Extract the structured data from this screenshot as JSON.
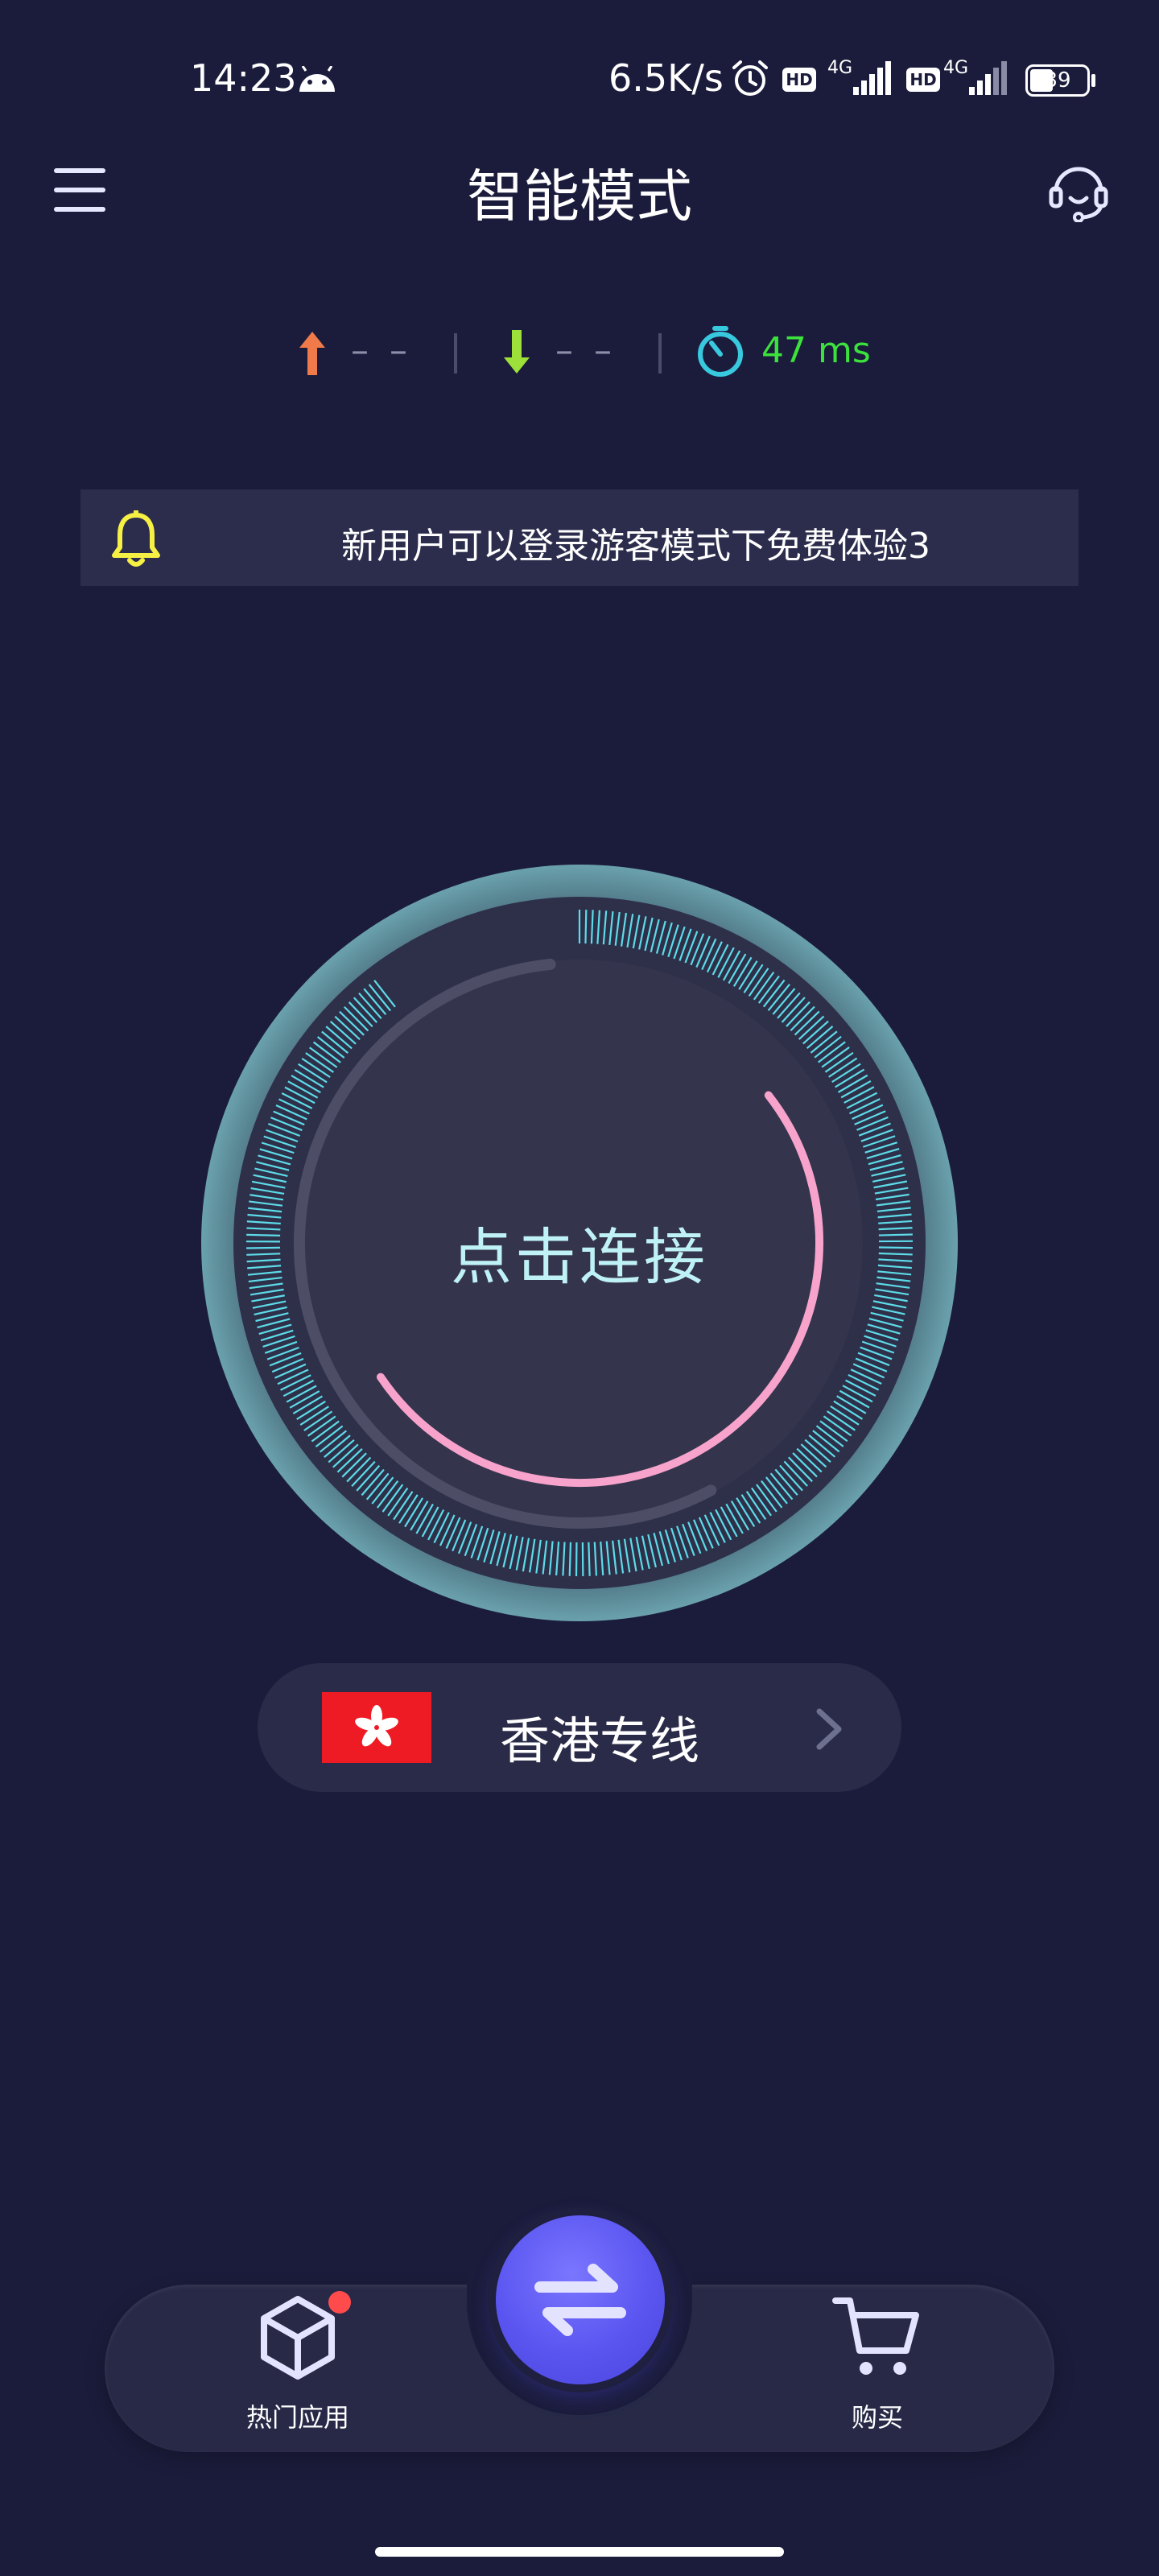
{
  "status_bar": {
    "time": "14:23",
    "net_speed": "6.5K/s",
    "battery": "39",
    "signal_1": "4G",
    "signal_2": "4G",
    "hd_1": "HD",
    "hd_2": "HD"
  },
  "header": {
    "title": "智能模式"
  },
  "stats": {
    "upload": "– –",
    "download": "– –",
    "ping": "47 ms"
  },
  "notice": {
    "text": "新用户可以登录游客模式下免费体验3"
  },
  "dial": {
    "label": "点击连接"
  },
  "line": {
    "name": "香港专线"
  },
  "bottom_nav": {
    "hot_apps_label": "热门应用",
    "buy_label": "购买"
  },
  "colors": {
    "background": "#1b1c3b",
    "accent_cyan": "#5ddbe8",
    "accent_pink": "#f7a3cc",
    "ping_green": "#3ce23c",
    "upload_orange": "#f07a4a",
    "download_green": "#9ee03a",
    "bell_yellow": "#f6f045",
    "button_purple": "#5a55f0"
  }
}
